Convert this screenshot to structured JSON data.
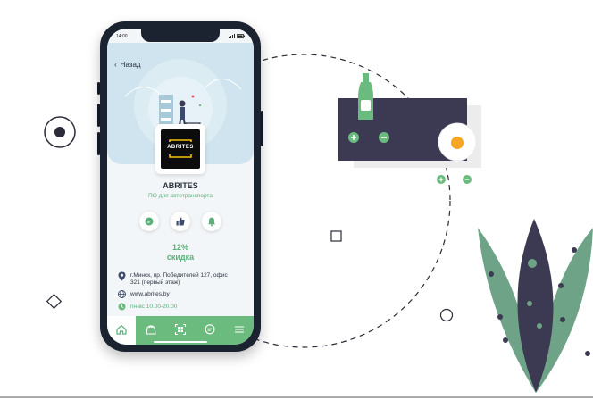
{
  "phone": {
    "status_time": "14:00",
    "back_label": "Назад",
    "company": {
      "logo_text": "ABRITES",
      "name": "ABRITES",
      "category": "ПО для автотранспорта"
    },
    "actions": [
      {
        "icon": "chat-icon"
      },
      {
        "icon": "thumbs-up-icon"
      },
      {
        "icon": "bell-icon"
      }
    ],
    "discount": {
      "percent": "12%",
      "label": "скидка"
    },
    "info": {
      "address_line1": "г.Минск, пр. Победителей 127, офис",
      "address_line2": "321 (первый этаж)",
      "website": "www.abrites.by",
      "hours": "пн-вс 10.00-20.00"
    },
    "tabs": [
      {
        "icon": "home-icon",
        "active": true
      },
      {
        "icon": "discount-bag-icon"
      },
      {
        "icon": "qr-scan-icon"
      },
      {
        "icon": "chat-icon"
      },
      {
        "icon": "menu-icon"
      }
    ]
  },
  "colors": {
    "accent_green": "#6cbb7e",
    "text_green": "#59b07a",
    "dark": "#3b3a52",
    "header_blue": "#cfe4ee"
  }
}
